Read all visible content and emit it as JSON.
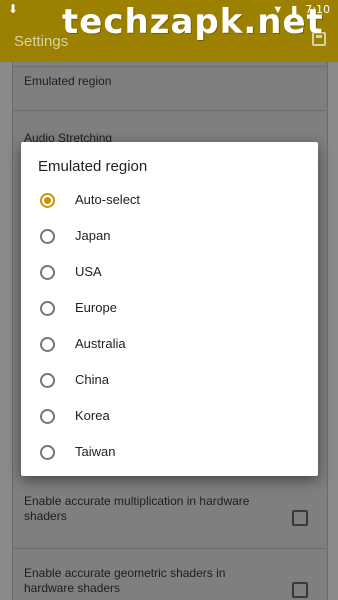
{
  "status_bar": {
    "time": "7:10"
  },
  "watermark": "techzapk.net",
  "app_bar": {
    "title": "Settings"
  },
  "settings": [
    {
      "label": "Emulated region"
    },
    {
      "label": "Audio Stretching"
    },
    {
      "label": "Enable accurate multiplication in hardware shaders"
    },
    {
      "label": "Enable accurate geometric shaders in hardware shaders"
    }
  ],
  "dialog": {
    "title": "Emulated region",
    "selected": "Auto-select",
    "options": [
      "Auto-select",
      "Japan",
      "USA",
      "Europe",
      "Australia",
      "China",
      "Korea",
      "Taiwan"
    ]
  },
  "colors": {
    "accent": "#c79400",
    "app_bar": "#9c8100"
  }
}
